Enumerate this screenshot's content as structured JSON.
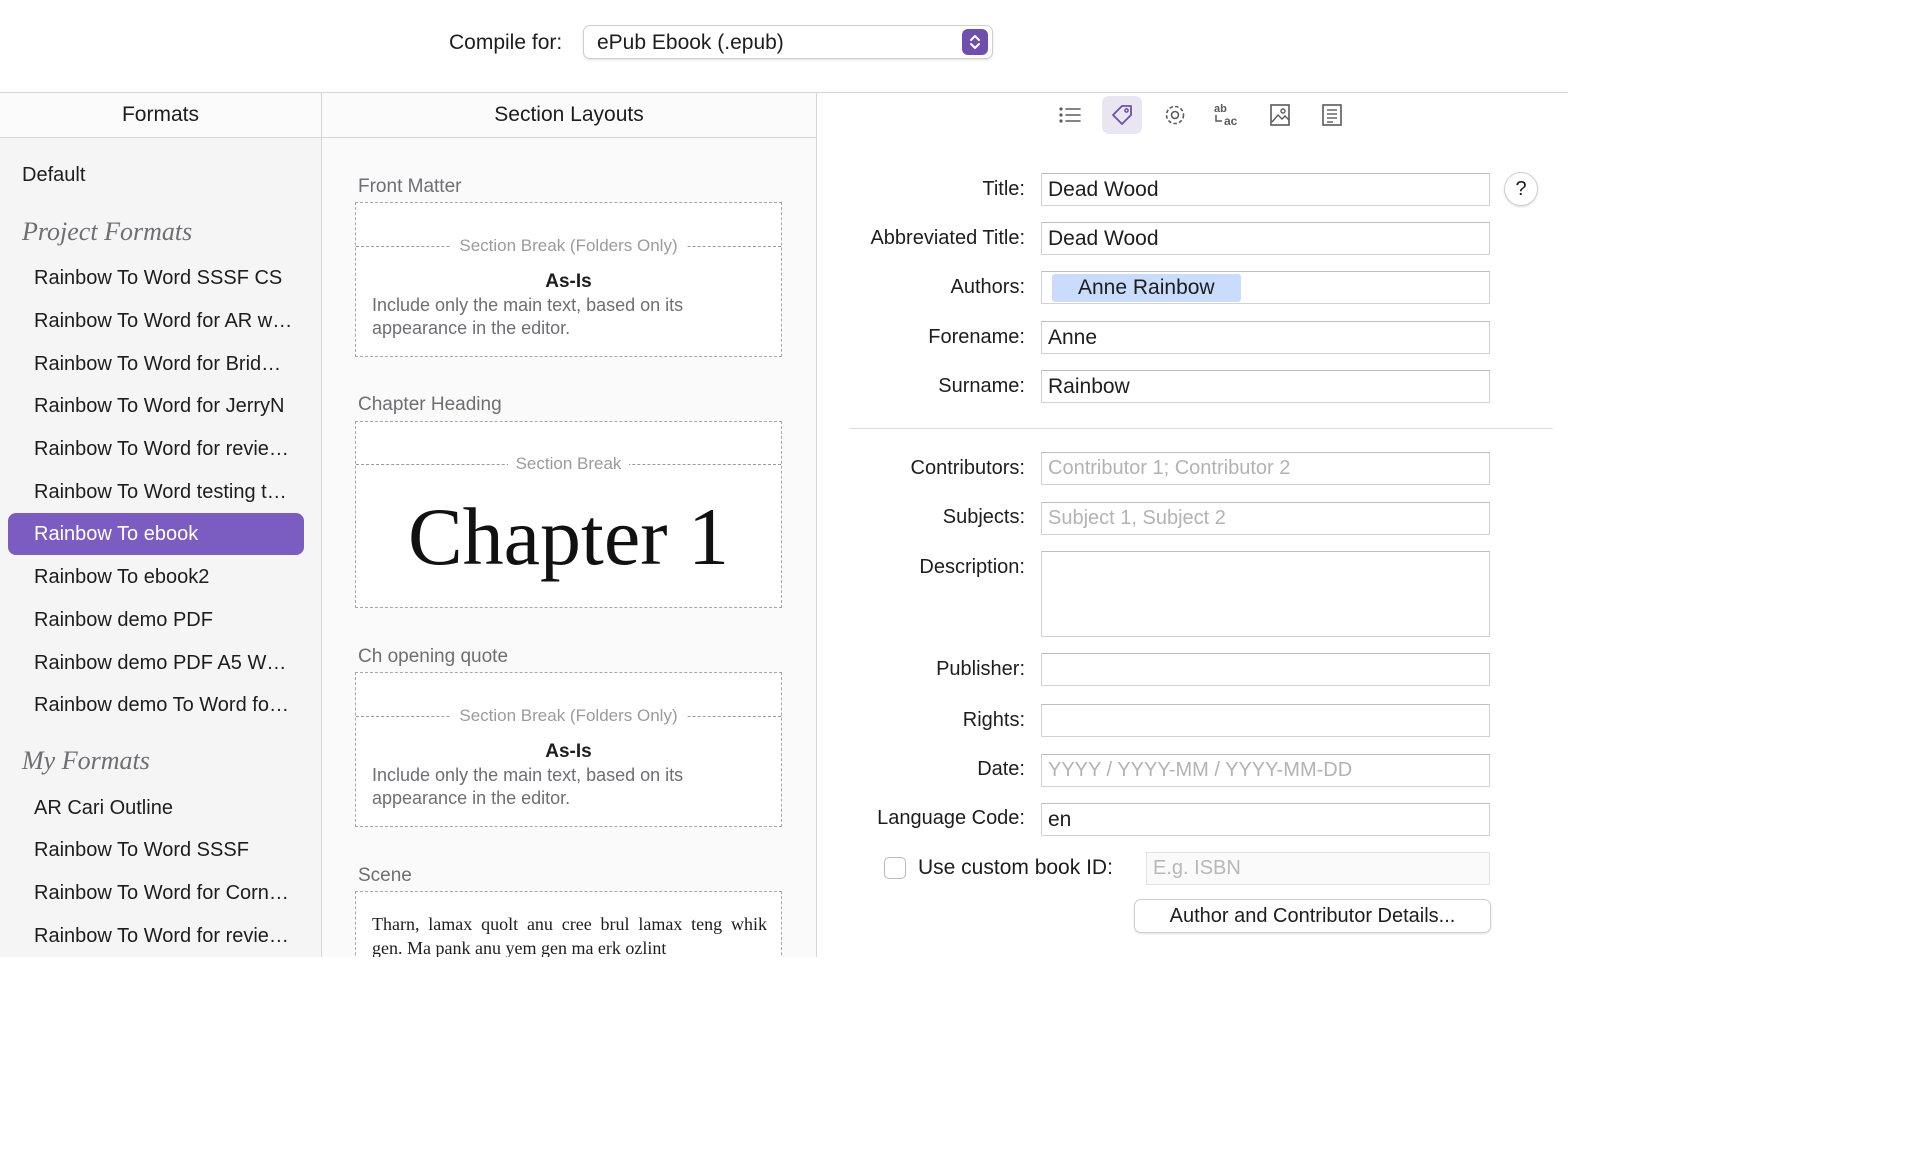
{
  "topbar": {
    "compile_label": "Compile for:",
    "compile_value": "ePub Ebook (.epub)"
  },
  "headers": {
    "formats": "Formats",
    "section_layouts": "Section Layouts"
  },
  "formats": {
    "default": "Default",
    "project_group": "Project Formats",
    "project_items": [
      "Rainbow To Word SSSF CS",
      "Rainbow To Word for AR w…",
      "Rainbow To Word for Brid…",
      "Rainbow To Word for JerryN",
      "Rainbow To Word for revie…",
      "Rainbow To Word testing t…",
      "Rainbow To ebook",
      "Rainbow To ebook2",
      "Rainbow demo PDF",
      "Rainbow demo PDF A5 W…",
      "Rainbow demo To Word fo…"
    ],
    "selected_index": 6,
    "my_group": "My Formats",
    "my_items": [
      "AR Cari Outline",
      "Rainbow To Word SSSF",
      "Rainbow To Word for Corn…",
      "Rainbow To Word for revie…"
    ]
  },
  "sections": {
    "front_matter": {
      "label": "Front Matter",
      "break": "Section Break (Folders Only)",
      "title": "As-Is",
      "desc": "Include only the main text, based on its appearance in the editor."
    },
    "chapter_heading": {
      "label": "Chapter Heading",
      "break": "Section Break",
      "preview": "Chapter 1"
    },
    "opening_quote": {
      "label": "Ch opening quote",
      "break": "Section Break (Folders Only)",
      "title": "As-Is",
      "desc": "Include only the main text, based on its appearance in the editor."
    },
    "scene": {
      "label": "Scene",
      "text": "Tharn, lamax quolt anu cree brul lamax teng whik gen. Ma pank anu yem gen ma erk ozlint"
    }
  },
  "metadata": {
    "title_label": "Title:",
    "title_value": "Dead Wood",
    "abbrev_label": "Abbreviated Title:",
    "abbrev_value": "Dead Wood",
    "authors_label": "Authors:",
    "authors_token": "Anne Rainbow",
    "forename_label": "Forename:",
    "forename_value": "Anne",
    "surname_label": "Surname:",
    "surname_value": "Rainbow",
    "contributors_label": "Contributors:",
    "contributors_placeholder": "Contributor 1; Contributor 2",
    "subjects_label": "Subjects:",
    "subjects_placeholder": "Subject 1, Subject 2",
    "description_label": "Description:",
    "publisher_label": "Publisher:",
    "rights_label": "Rights:",
    "date_label": "Date:",
    "date_placeholder": "YYYY / YYYY-MM / YYYY-MM-DD",
    "language_label": "Language Code:",
    "language_value": "en",
    "custom_id_label": "Use custom book ID:",
    "custom_id_placeholder": "E.g. ISBN",
    "details_button": "Author and Contributor Details...",
    "help": "?"
  },
  "colors": {
    "accent": "#7b5dc2"
  }
}
